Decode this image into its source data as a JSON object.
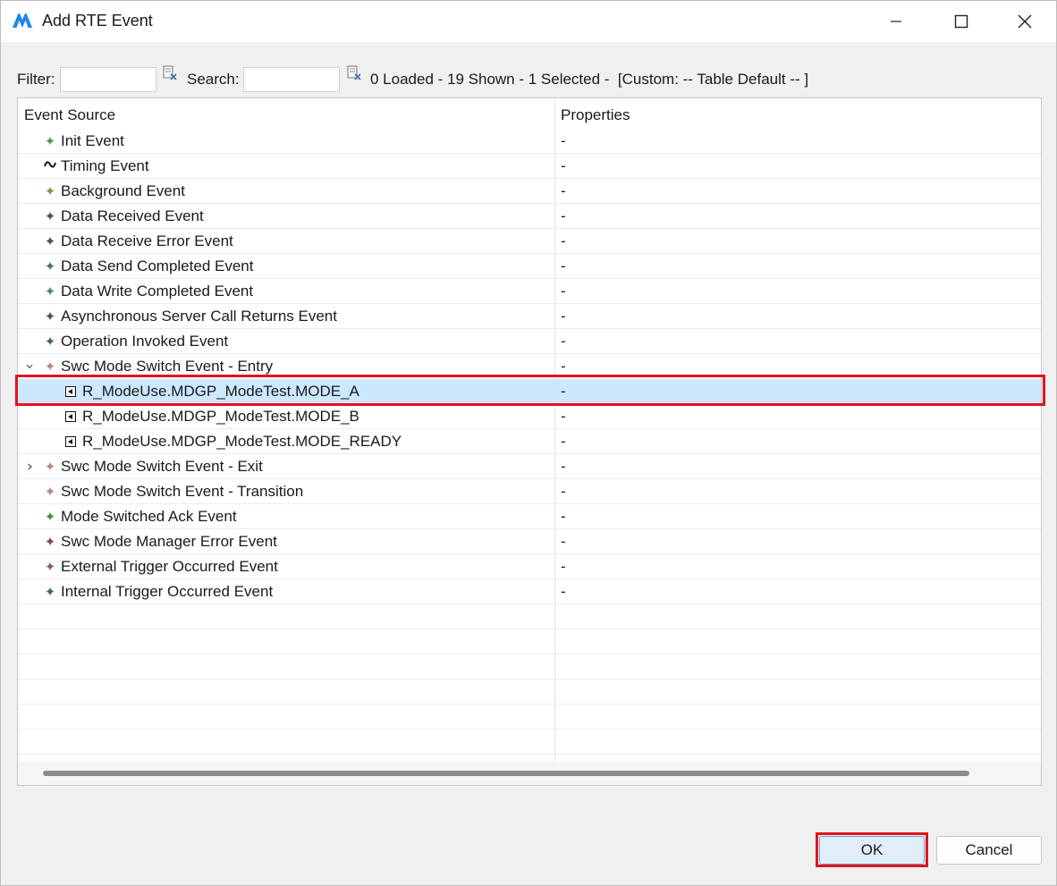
{
  "window": {
    "title": "Add RTE Event"
  },
  "filter": {
    "filter_label": "Filter:",
    "filter_value": "",
    "search_label": "Search:",
    "search_value": ""
  },
  "status": {
    "text": "0 Loaded - 19 Shown - 1 Selected -  [Custom: -- Table Default -- ]"
  },
  "table": {
    "headers": [
      "Event Source",
      "Properties"
    ],
    "rows": [
      {
        "label": "Init Event",
        "prop": "-",
        "icon": "sparkle-icon",
        "icon_color": "#4f9a5a",
        "level": 0,
        "expander": "",
        "selected": false
      },
      {
        "label": "Timing Event",
        "prop": "-",
        "icon": "wave-icon",
        "icon_color": "#111111",
        "level": 0,
        "expander": "",
        "selected": false
      },
      {
        "label": "Background Event",
        "prop": "-",
        "icon": "sparkle-icon",
        "icon_color": "#9a8a4a",
        "level": 0,
        "expander": "",
        "selected": false
      },
      {
        "label": "Data Received Event",
        "prop": "-",
        "icon": "sparkle-icon",
        "icon_color": "#3f5a4a",
        "level": 0,
        "expander": "",
        "selected": false
      },
      {
        "label": "Data Receive Error Event",
        "prop": "-",
        "icon": "sparkle-icon",
        "icon_color": "#3f5a4a",
        "level": 0,
        "expander": "",
        "selected": false
      },
      {
        "label": "Data Send Completed Event",
        "prop": "-",
        "icon": "sparkle-icon",
        "icon_color": "#3f7a4a",
        "level": 0,
        "expander": "",
        "selected": false
      },
      {
        "label": "Data Write Completed Event",
        "prop": "-",
        "icon": "sparkle-icon",
        "icon_color": "#4a8a5a",
        "level": 0,
        "expander": "",
        "selected": false
      },
      {
        "label": "Asynchronous Server Call Returns Event",
        "prop": "-",
        "icon": "sparkle-icon",
        "icon_color": "#3f5a4a",
        "level": 0,
        "expander": "",
        "selected": false
      },
      {
        "label": "Operation Invoked Event",
        "prop": "-",
        "icon": "sparkle-icon",
        "icon_color": "#3f6a4a",
        "level": 0,
        "expander": "",
        "selected": false
      },
      {
        "label": "Swc Mode Switch Event - Entry",
        "prop": "-",
        "icon": "sparkle-icon",
        "icon_color": "#b08a7a",
        "level": 0,
        "expander": "expanded",
        "selected": false
      },
      {
        "label": "R_ModeUse.MDGP_ModeTest.MODE_A",
        "prop": "-",
        "icon": "mode-icon",
        "icon_color": "#111111",
        "level": 1,
        "expander": "",
        "selected": true
      },
      {
        "label": "R_ModeUse.MDGP_ModeTest.MODE_B",
        "prop": "-",
        "icon": "mode-icon",
        "icon_color": "#111111",
        "level": 1,
        "expander": "",
        "selected": false
      },
      {
        "label": "R_ModeUse.MDGP_ModeTest.MODE_READY",
        "prop": "-",
        "icon": "mode-icon",
        "icon_color": "#111111",
        "level": 1,
        "expander": "",
        "selected": false
      },
      {
        "label": "Swc Mode Switch Event - Exit",
        "prop": "-",
        "icon": "sparkle-icon",
        "icon_color": "#b08a7a",
        "level": 0,
        "expander": "collapsed",
        "selected": false
      },
      {
        "label": "Swc Mode Switch Event - Transition",
        "prop": "-",
        "icon": "sparkle-icon",
        "icon_color": "#b08a7a",
        "level": 0,
        "expander": "",
        "selected": false
      },
      {
        "label": "Mode Switched Ack Event",
        "prop": "-",
        "icon": "sparkle-icon",
        "icon_color": "#3f8a4a",
        "level": 0,
        "expander": "",
        "selected": false
      },
      {
        "label": "Swc Mode Manager Error Event",
        "prop": "-",
        "icon": "sparkle-icon",
        "icon_color": "#7a4a3a",
        "level": 0,
        "expander": "",
        "selected": false
      },
      {
        "label": "External Trigger Occurred Event",
        "prop": "-",
        "icon": "sparkle-icon",
        "icon_color": "#8a5a7a",
        "level": 0,
        "expander": "",
        "selected": false
      },
      {
        "label": "Internal Trigger Occurred Event",
        "prop": "-",
        "icon": "sparkle-icon",
        "icon_color": "#3f6a5a",
        "level": 0,
        "expander": "",
        "selected": false
      }
    ]
  },
  "buttons": {
    "ok": "OK",
    "cancel": "Cancel"
  },
  "colors": {
    "selection": "#cce8ff",
    "highlight": "#e0141e",
    "app_icon": "#1e88e5"
  }
}
